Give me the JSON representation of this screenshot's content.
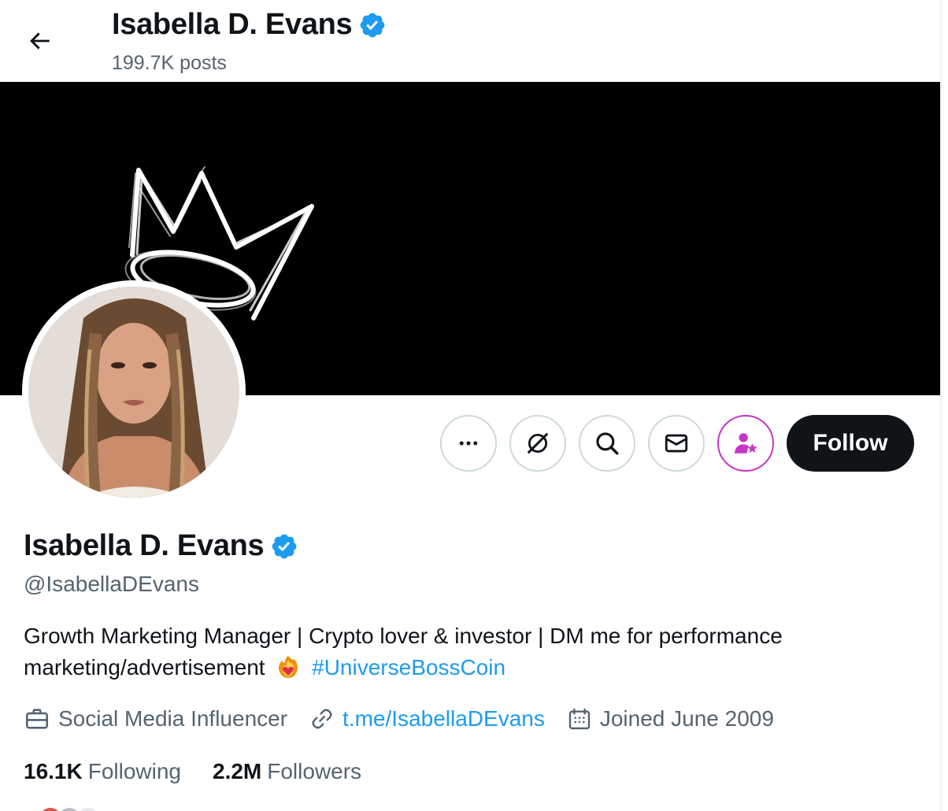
{
  "header": {
    "name": "Isabella D. Evans",
    "posts": "199.7K posts"
  },
  "profile": {
    "name": "Isabella D. Evans",
    "handle": "@IsabellaDEvans",
    "bio_text": "Growth Marketing Manager | Crypto lover & investor | DM me for performance marketing/advertisement",
    "bio_hashtag": "#UniverseBossCoin",
    "category": "Social Media Influencer",
    "website": "t.me/IsabellaDEvans",
    "joined": "Joined June 2009",
    "following_count": "16.1K",
    "following_label": "Following",
    "followers_count": "2.2M",
    "followers_label": "Followers"
  },
  "actions": {
    "follow_label": "Follow"
  },
  "icons": [
    "back-arrow-icon",
    "verified-badge-icon",
    "more-icon",
    "grok-icon",
    "search-icon",
    "mail-icon",
    "subscribe-icon",
    "briefcase-icon",
    "link-icon",
    "calendar-icon",
    "fire-heart-emoji"
  ],
  "colors": {
    "accent": "#1d9bf0",
    "text": "#0f1419",
    "muted": "#536471",
    "subscribe": "#c936c9",
    "follow_bg": "#0f1419"
  }
}
